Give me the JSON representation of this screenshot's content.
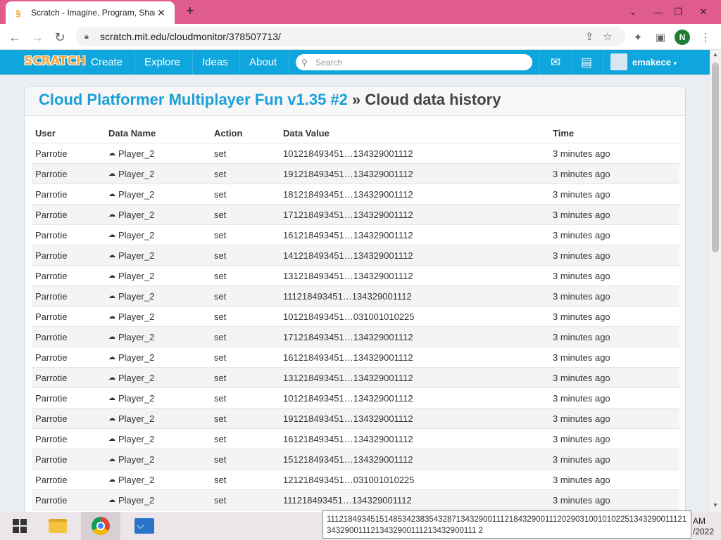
{
  "browser": {
    "tab_title": "Scratch - Imagine, Program, Shar",
    "tab_favicon": "scratch-cat-icon",
    "url": "scratch.mit.edu/cloudmonitor/378507713/",
    "profile_initial": "N"
  },
  "nav": {
    "logo": "SCRATCH",
    "links": [
      "Create",
      "Explore",
      "Ideas",
      "About"
    ],
    "search_placeholder": "Search",
    "username": "emakece"
  },
  "page": {
    "project_title": "Cloud Platformer Multiplayer Fun v1.35 #2",
    "separator": " » ",
    "subtitle": "Cloud data history"
  },
  "table": {
    "headers": [
      "User",
      "Data Name",
      "Action",
      "Data Value",
      "Time"
    ],
    "rows": [
      {
        "user": "Parrotie",
        "name": "Player_2",
        "action": "set",
        "value": "101218493451…134329001112",
        "time": "3 minutes ago"
      },
      {
        "user": "Parrotie",
        "name": "Player_2",
        "action": "set",
        "value": "191218493451…134329001112",
        "time": "3 minutes ago"
      },
      {
        "user": "Parrotie",
        "name": "Player_2",
        "action": "set",
        "value": "181218493451…134329001112",
        "time": "3 minutes ago"
      },
      {
        "user": "Parrotie",
        "name": "Player_2",
        "action": "set",
        "value": "171218493451…134329001112",
        "time": "3 minutes ago"
      },
      {
        "user": "Parrotie",
        "name": "Player_2",
        "action": "set",
        "value": "161218493451…134329001112",
        "time": "3 minutes ago"
      },
      {
        "user": "Parrotie",
        "name": "Player_2",
        "action": "set",
        "value": "141218493451…134329001112",
        "time": "3 minutes ago"
      },
      {
        "user": "Parrotie",
        "name": "Player_2",
        "action": "set",
        "value": "131218493451…134329001112",
        "time": "3 minutes ago"
      },
      {
        "user": "Parrotie",
        "name": "Player_2",
        "action": "set",
        "value": "111218493451…134329001112",
        "time": "3 minutes ago"
      },
      {
        "user": "Parrotie",
        "name": "Player_2",
        "action": "set",
        "value": "101218493451…031001010225",
        "time": "3 minutes ago"
      },
      {
        "user": "Parrotie",
        "name": "Player_2",
        "action": "set",
        "value": "171218493451…134329001112",
        "time": "3 minutes ago"
      },
      {
        "user": "Parrotie",
        "name": "Player_2",
        "action": "set",
        "value": "161218493451…134329001112",
        "time": "3 minutes ago"
      },
      {
        "user": "Parrotie",
        "name": "Player_2",
        "action": "set",
        "value": "131218493451…134329001112",
        "time": "3 minutes ago"
      },
      {
        "user": "Parrotie",
        "name": "Player_2",
        "action": "set",
        "value": "101218493451…134329001112",
        "time": "3 minutes ago"
      },
      {
        "user": "Parrotie",
        "name": "Player_2",
        "action": "set",
        "value": "191218493451…134329001112",
        "time": "3 minutes ago"
      },
      {
        "user": "Parrotie",
        "name": "Player_2",
        "action": "set",
        "value": "161218493451…134329001112",
        "time": "3 minutes ago"
      },
      {
        "user": "Parrotie",
        "name": "Player_2",
        "action": "set",
        "value": "151218493451…134329001112",
        "time": "3 minutes ago"
      },
      {
        "user": "Parrotie",
        "name": "Player_2",
        "action": "set",
        "value": "121218493451…031001010225",
        "time": "3 minutes ago"
      },
      {
        "user": "Parrotie",
        "name": "Player_2",
        "action": "set",
        "value": "111218493451…134329001112",
        "time": "3 minutes ago"
      }
    ]
  },
  "tooltip": "1112184934515148534238354328713432900111218432900111202903100101022513432900111213432900111213432900111213432900111 2",
  "taskbar": {
    "clock_time": "AM",
    "clock_date": "/2022"
  },
  "colors": {
    "tabstrip": "#e05c8e",
    "scratch_blue": "#0fa5dd",
    "link_blue": "#1aa0d8"
  }
}
